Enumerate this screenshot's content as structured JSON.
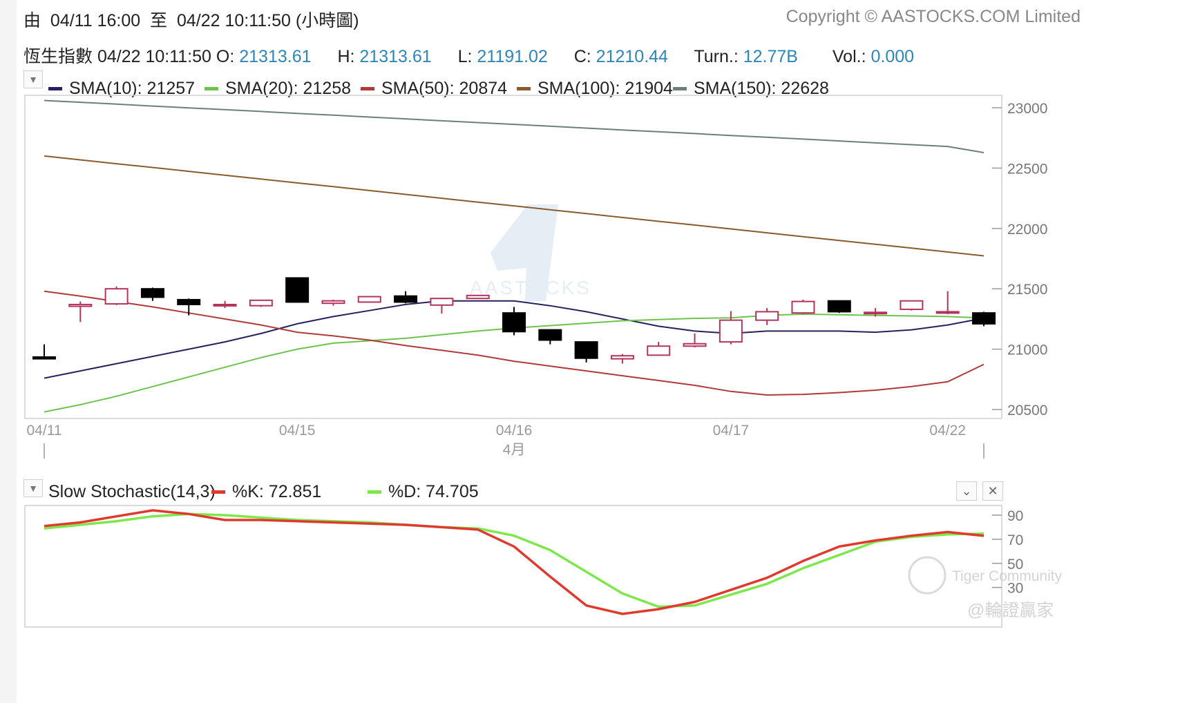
{
  "header": {
    "range_prefix": "由",
    "range_from": "04/11 16:00",
    "range_to_word": "至",
    "range_to": "04/22 10:11:50 (小時圖)",
    "copyright": "Copyright © AASTOCKS.COM Limited"
  },
  "quote": {
    "name": "恆生指數",
    "time": "04/22 10:11:50",
    "open_label": "O:",
    "open": "21313.61",
    "high_label": "H:",
    "high": "21313.61",
    "low_label": "L:",
    "low": "21191.02",
    "close_label": "C:",
    "close": "21210.44",
    "turn_label": "Turn.:",
    "turn": "12.77B",
    "vol_label": "Vol.:",
    "vol": "0.000"
  },
  "legend": [
    {
      "label": "SMA(10): 21257",
      "color": "#25215e"
    },
    {
      "label": "SMA(20): 21258",
      "color": "#6cc44a"
    },
    {
      "label": "SMA(50): 20874",
      "color": "#b03a3a"
    },
    {
      "label": "SMA(100): 21904",
      "color": "#8b5a2b"
    },
    {
      "label": "SMA(150): 22628",
      "color": "#6d7f7b"
    }
  ],
  "stoch_legend": {
    "title": "Slow Stochastic(14,3)",
    "k_label": "%K: 72.851",
    "k_color": "#e03a2f",
    "d_label": "%D: 74.705",
    "d_color": "#7de84a"
  },
  "watermark": {
    "brand": "AASTOCKS",
    "community": "Tiger Community",
    "handle": "@輪證贏家"
  },
  "chart_data": [
    {
      "type": "candlestick",
      "title": "恆生指數",
      "xlabel": "",
      "ylabel": "",
      "ylim": [
        20450,
        23050
      ],
      "y_ticks": [
        20500,
        21000,
        21500,
        22000,
        22500,
        23000
      ],
      "x_tick_labels": [
        {
          "index": 0,
          "label": "04/11"
        },
        {
          "index": 7,
          "label": "04/15"
        },
        {
          "index": 13,
          "label": "04/16"
        },
        {
          "index": 19,
          "label": "04/17"
        },
        {
          "index": 25,
          "label": "04/22"
        }
      ],
      "x_sublabel": {
        "index": 13,
        "label": "4月"
      },
      "grid": false,
      "candles": [
        {
          "o": 20935,
          "h": 21040,
          "l": 20915,
          "c": 20920
        },
        {
          "o": 21355,
          "h": 21395,
          "l": 21225,
          "c": 21370
        },
        {
          "o": 21375,
          "h": 21520,
          "l": 21365,
          "c": 21500
        },
        {
          "o": 21500,
          "h": 21510,
          "l": 21400,
          "c": 21430
        },
        {
          "o": 21410,
          "h": 21420,
          "l": 21280,
          "c": 21370
        },
        {
          "o": 21370,
          "h": 21400,
          "l": 21340,
          "c": 21370
        },
        {
          "o": 21360,
          "h": 21410,
          "l": 21350,
          "c": 21405
        },
        {
          "o": 21590,
          "h": 21590,
          "l": 21385,
          "c": 21390
        },
        {
          "o": 21380,
          "h": 21410,
          "l": 21360,
          "c": 21400
        },
        {
          "o": 21390,
          "h": 21440,
          "l": 21385,
          "c": 21435
        },
        {
          "o": 21440,
          "h": 21480,
          "l": 21380,
          "c": 21390
        },
        {
          "o": 21365,
          "h": 21425,
          "l": 21295,
          "c": 21420
        },
        {
          "o": 21420,
          "h": 21445,
          "l": 21415,
          "c": 21445
        },
        {
          "o": 21300,
          "h": 21350,
          "l": 21115,
          "c": 21145
        },
        {
          "o": 21160,
          "h": 21160,
          "l": 21040,
          "c": 21075
        },
        {
          "o": 21060,
          "h": 21060,
          "l": 20890,
          "c": 20925
        },
        {
          "o": 20920,
          "h": 20960,
          "l": 20880,
          "c": 20945
        },
        {
          "o": 20950,
          "h": 21060,
          "l": 20945,
          "c": 21025
        },
        {
          "o": 21025,
          "h": 21130,
          "l": 21015,
          "c": 21045
        },
        {
          "o": 21060,
          "h": 21315,
          "l": 21040,
          "c": 21240
        },
        {
          "o": 21240,
          "h": 21340,
          "l": 21200,
          "c": 21310
        },
        {
          "o": 21300,
          "h": 21410,
          "l": 21290,
          "c": 21395
        },
        {
          "o": 21400,
          "h": 21400,
          "l": 21300,
          "c": 21310
        },
        {
          "o": 21305,
          "h": 21340,
          "l": 21270,
          "c": 21305
        },
        {
          "o": 21330,
          "h": 21400,
          "l": 21320,
          "c": 21400
        },
        {
          "o": 21310,
          "h": 21480,
          "l": 21290,
          "c": 21310
        },
        {
          "o": 21300,
          "h": 21310,
          "l": 21190,
          "c": 21210
        }
      ],
      "series": [
        {
          "name": "SMA(10)",
          "color": "#25215e",
          "values": [
            20760,
            20820,
            20880,
            20940,
            21000,
            21060,
            21130,
            21210,
            21270,
            21320,
            21370,
            21400,
            21400,
            21400,
            21360,
            21310,
            21250,
            21190,
            21150,
            21130,
            21150,
            21150,
            21150,
            21140,
            21160,
            21200,
            21257
          ]
        },
        {
          "name": "SMA(20)",
          "color": "#6cc44a",
          "values": [
            20480,
            20540,
            20610,
            20690,
            20770,
            20850,
            20930,
            21000,
            21050,
            21070,
            21090,
            21120,
            21150,
            21175,
            21195,
            21215,
            21235,
            21245,
            21255,
            21260,
            21280,
            21290,
            21285,
            21280,
            21275,
            21270,
            21258
          ]
        },
        {
          "name": "SMA(50)",
          "color": "#b03a3a",
          "values": [
            21480,
            21440,
            21395,
            21350,
            21300,
            21250,
            21200,
            21140,
            21110,
            21075,
            21030,
            20990,
            20950,
            20900,
            20860,
            20820,
            20780,
            20740,
            20700,
            20650,
            20620,
            20625,
            20640,
            20660,
            20690,
            20730,
            20874
          ]
        },
        {
          "name": "SMA(100)",
          "color": "#8b5a2b",
          "values": [
            22600,
            22568,
            22536,
            22505,
            22473,
            22441,
            22409,
            22377,
            22346,
            22314,
            22282,
            22250,
            22218,
            22187,
            22155,
            22123,
            22091,
            22059,
            22028,
            21996,
            21964,
            21932,
            21900,
            21869,
            21837,
            21805,
            21773
          ]
        },
        {
          "name": "SMA(150)",
          "color": "#6d7f7b",
          "values": [
            23060,
            23045,
            23030,
            23014,
            22999,
            22984,
            22969,
            22953,
            22938,
            22923,
            22908,
            22892,
            22877,
            22862,
            22847,
            22831,
            22816,
            22801,
            22786,
            22770,
            22755,
            22740,
            22725,
            22709,
            22694,
            22679,
            22628
          ]
        }
      ]
    },
    {
      "type": "line",
      "title": "Slow Stochastic(14,3)",
      "xlabel": "",
      "ylabel": "",
      "ylim": [
        0,
        100
      ],
      "y_ticks": [
        30,
        50,
        70,
        90
      ],
      "grid": false,
      "series": [
        {
          "name": "%K",
          "color": "#e03a2f",
          "values": [
            81,
            84,
            89,
            94,
            91,
            86,
            86,
            85,
            84,
            83,
            82,
            80,
            78,
            64,
            39,
            15,
            8,
            12,
            18,
            28,
            38,
            52,
            64,
            69,
            73,
            76,
            72.851
          ]
        },
        {
          "name": "%D",
          "color": "#7de84a",
          "values": [
            79,
            82,
            85,
            89,
            91,
            90,
            88,
            86,
            85,
            84,
            82,
            80,
            79,
            73,
            61,
            43,
            25,
            14,
            15,
            24,
            33,
            46,
            57,
            68,
            72,
            74,
            74.705
          ]
        }
      ]
    }
  ]
}
